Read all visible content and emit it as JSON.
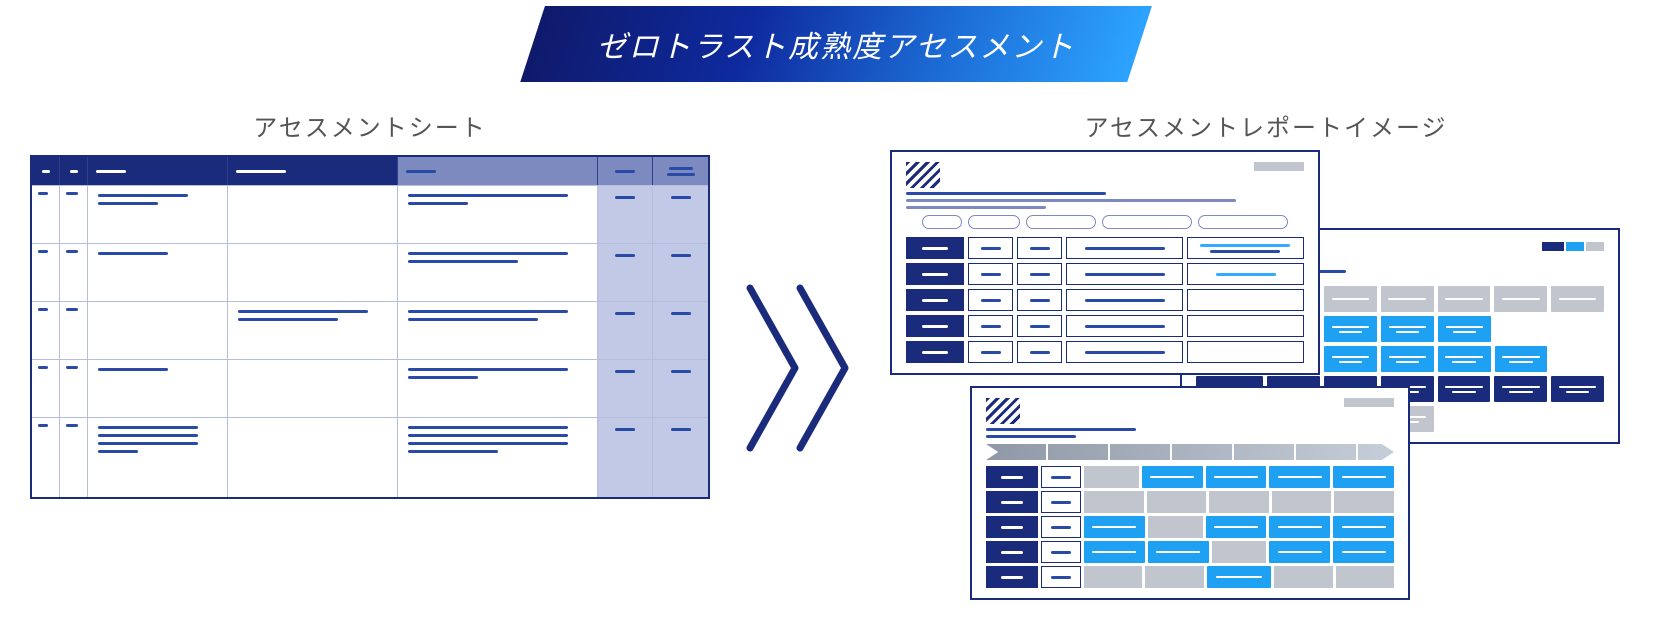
{
  "banner": {
    "title": "ゼロトラスト成熟度アセスメント"
  },
  "left": {
    "title": "アセスメントシート"
  },
  "right": {
    "title": "アセスメントレポートイメージ"
  }
}
